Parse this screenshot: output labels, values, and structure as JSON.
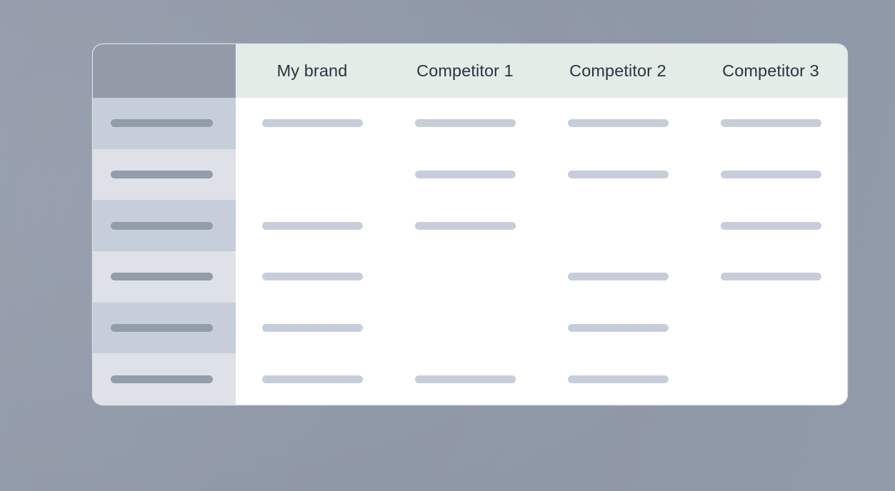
{
  "page": {
    "background_color": "#9099a8",
    "type": "comparison-table-placeholder"
  },
  "card": {
    "background_color": "#ffffff",
    "corner_radius_px": 14
  },
  "table": {
    "header": {
      "corner_cell_label": "",
      "corner_cell_color": "#939ba8",
      "cell_background": "#e4ece7",
      "text_color": "#2b3441",
      "columns": [
        {
          "label": "My brand"
        },
        {
          "label": "Competitor 1"
        },
        {
          "label": "Competitor 2"
        },
        {
          "label": "Competitor 3"
        }
      ]
    },
    "row_colors": {
      "sidebar_odd": "#c6ced9",
      "sidebar_even": "#dee2e8",
      "sidebar_bar": "#939ca9",
      "cell_bar": "#c7ced9"
    },
    "rows": [
      {
        "label": "",
        "stripe": "odd",
        "cells": [
          true,
          true,
          true,
          true
        ]
      },
      {
        "label": "",
        "stripe": "even",
        "cells": [
          false,
          true,
          true,
          true
        ]
      },
      {
        "label": "",
        "stripe": "odd",
        "cells": [
          true,
          true,
          false,
          true
        ]
      },
      {
        "label": "",
        "stripe": "even",
        "cells": [
          true,
          false,
          true,
          true
        ]
      },
      {
        "label": "",
        "stripe": "odd",
        "cells": [
          true,
          false,
          true,
          false
        ]
      },
      {
        "label": "",
        "stripe": "even",
        "cells": [
          true,
          true,
          true,
          false
        ]
      }
    ]
  }
}
